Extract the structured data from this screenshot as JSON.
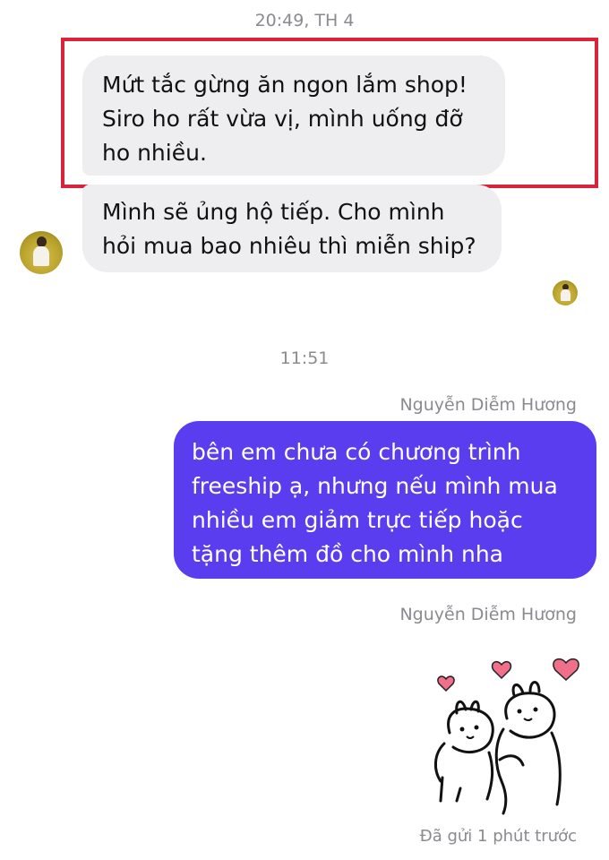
{
  "conversation": {
    "timestamp_1": "20:49, TH 4",
    "incoming": [
      {
        "lines": [
          "Mứt tắc gừng ăn ngon lắm shop!",
          "Siro ho rất vừa vị, mình uống đỡ",
          "ho nhiều."
        ]
      },
      {
        "lines": [
          "Mình sẽ ủng hộ tiếp. Cho mình",
          "hỏi mua bao nhiêu thì miễn ship?"
        ]
      }
    ],
    "timestamp_2": "11:51",
    "sender_name_1": "Nguyễn Diễm Hương",
    "outgoing": {
      "lines": [
        "bên em chưa có chương trình",
        "freeship ạ, nhưng nếu mình mua",
        "nhiều em giảm trực tiếp hoặc",
        "tặng thêm đồ cho mình nha"
      ]
    },
    "sender_name_2": "Nguyễn Diễm Hương",
    "sticker_icon": "bunny-couple-hearts-sticker",
    "sent_status": "Đã gửi 1 phút trước"
  },
  "colors": {
    "incoming_bubble": "#eeeef1",
    "outgoing_bubble": "#5b3df0",
    "highlight_border": "#d8243a",
    "meta_text": "#8a8a8f",
    "heart": "#f0708a"
  }
}
